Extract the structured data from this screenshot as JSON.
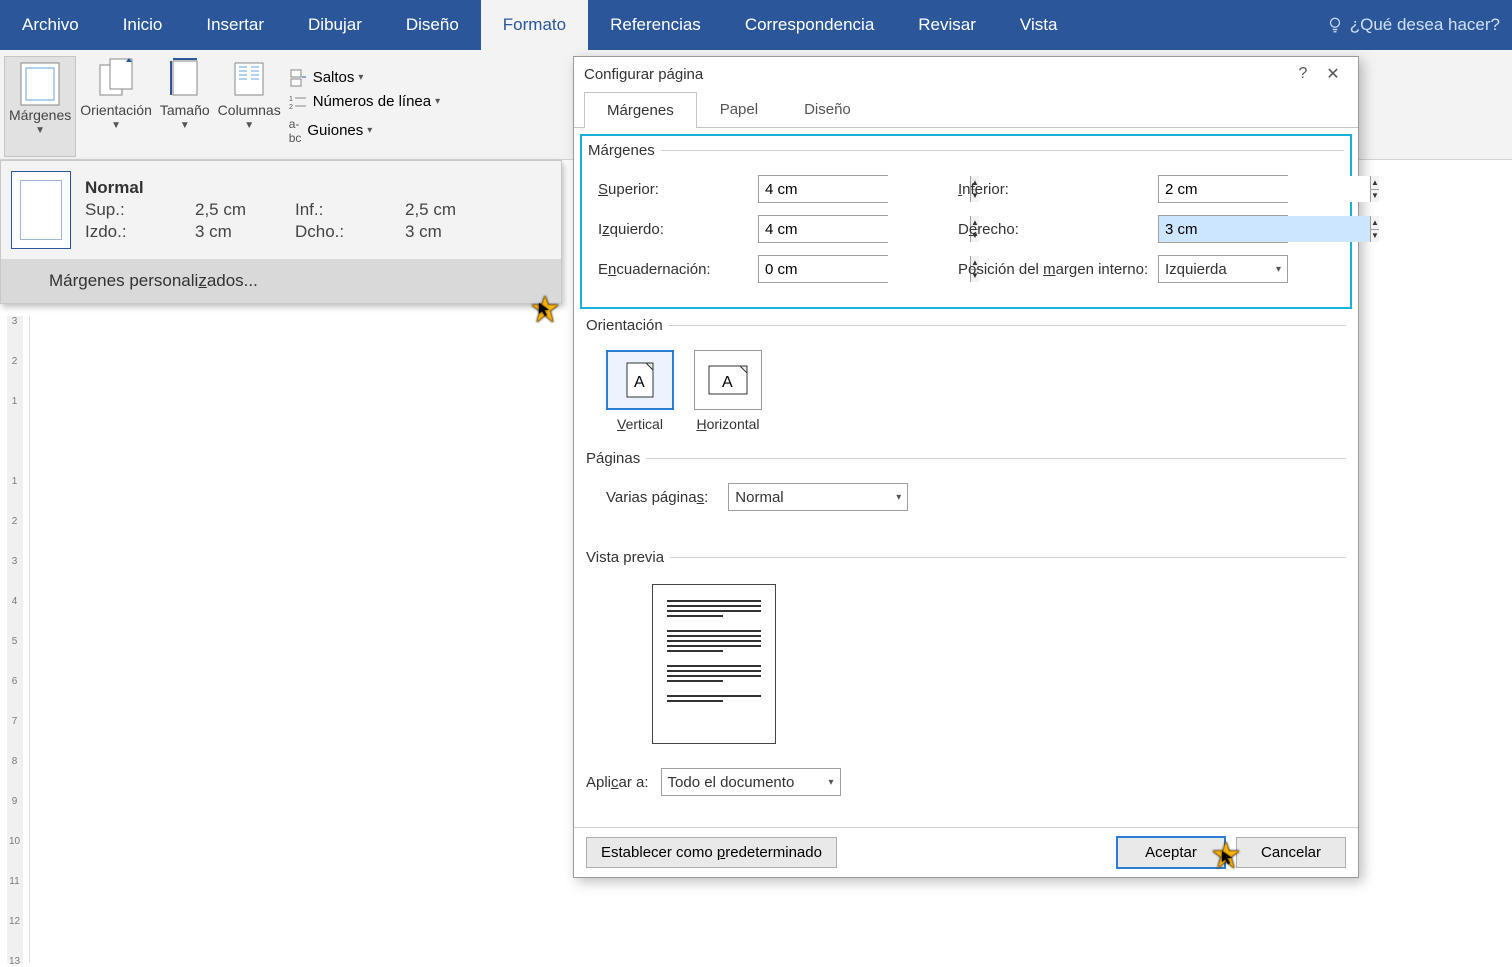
{
  "ribbon": {
    "tabs": [
      "Archivo",
      "Inicio",
      "Insertar",
      "Dibujar",
      "Diseño",
      "Formato",
      "Referencias",
      "Correspondencia",
      "Revisar",
      "Vista"
    ],
    "active_index": 5,
    "tell_me": "¿Qué desea hacer?",
    "groups": {
      "margenes": "Márgenes",
      "orientacion": "Orientación",
      "tamano": "Tamaño",
      "columnas": "Columnas",
      "saltos": "Saltos",
      "numeros_linea": "Números de línea",
      "guiones": "Guiones"
    }
  },
  "preset": {
    "title": "Normal",
    "sup_label": "Sup.:",
    "sup_val": "2,5 cm",
    "inf_label": "Inf.:",
    "inf_val": "2,5 cm",
    "izq_label": "Izdo.:",
    "izq_val": "3 cm",
    "der_label": "Dcho.:",
    "der_val": "3 cm",
    "custom": "Márgenes personalizados..."
  },
  "dialog": {
    "title": "Configurar página",
    "tabs": [
      "Márgenes",
      "Papel",
      "Diseño"
    ],
    "active_tab": 0,
    "margins": {
      "legend": "Márgenes",
      "superior_label": "Superior:",
      "superior_val": "4 cm",
      "inferior_label": "Inferior:",
      "inferior_val": "2 cm",
      "izquierdo_label": "Izquierdo:",
      "izquierdo_val": "4 cm",
      "derecho_label": "Derecho:",
      "derecho_val": "3 cm",
      "encuad_label": "Encuadernación:",
      "encuad_val": "0 cm",
      "pos_label": "Posición del margen interno:",
      "pos_val": "Izquierda"
    },
    "orientation": {
      "legend": "Orientación",
      "vertical": "Vertical",
      "horizontal": "Horizontal",
      "active": "vertical"
    },
    "pages": {
      "legend": "Páginas",
      "varias_label": "Varias páginas:",
      "varias_val": "Normal"
    },
    "preview": {
      "legend": "Vista previa"
    },
    "apply": {
      "label": "Aplicar a:",
      "value": "Todo el documento"
    },
    "footer": {
      "set_default": "Establecer como predeterminado",
      "ok": "Aceptar",
      "cancel": "Cancelar"
    }
  },
  "ruler_marks": [
    "3",
    "2",
    "1",
    "",
    "1",
    "2",
    "3",
    "4",
    "5",
    "6",
    "7",
    "8",
    "9",
    "10",
    "11",
    "12",
    "13"
  ]
}
